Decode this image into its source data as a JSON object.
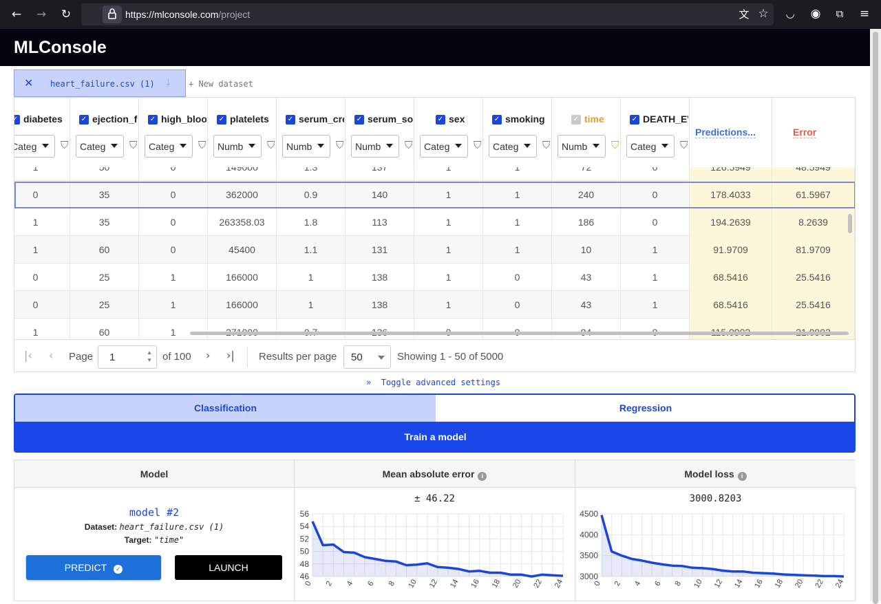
{
  "browser": {
    "url_host": "https://mlconsole.com",
    "url_path": "/project"
  },
  "app": {
    "title": "MLConsole"
  },
  "dataset_tabs": {
    "active": "heart_failure.csv (1)",
    "new_label": "+ New dataset"
  },
  "columns": [
    {
      "name": "diabetes",
      "checked": true,
      "type": "Categ"
    },
    {
      "name": "ejection_fraction",
      "checked": true,
      "type": "Categ"
    },
    {
      "name": "high_blood_pressure",
      "checked": true,
      "type": "Categ"
    },
    {
      "name": "platelets",
      "checked": true,
      "type": "Numb"
    },
    {
      "name": "serum_creatinine",
      "checked": true,
      "type": "Numb"
    },
    {
      "name": "serum_sodium",
      "checked": true,
      "type": "Numb"
    },
    {
      "name": "sex",
      "checked": true,
      "type": "Categ"
    },
    {
      "name": "smoking",
      "checked": true,
      "type": "Categ"
    },
    {
      "name": "time",
      "checked": false,
      "type": "Numb",
      "target": true
    },
    {
      "name": "DEATH_EVENT",
      "checked": true,
      "type": "Categ"
    }
  ],
  "prediction_headers": {
    "predictions": "Predictions...",
    "error": "Error"
  },
  "rows": [
    [
      "1",
      "50",
      "0",
      "149000",
      "1.3",
      "137",
      "1",
      "1",
      "72",
      "0",
      "126.5949",
      "48.5949"
    ],
    [
      "0",
      "35",
      "0",
      "362000",
      "0.9",
      "140",
      "1",
      "1",
      "240",
      "0",
      "178.4033",
      "61.5967"
    ],
    [
      "1",
      "35",
      "0",
      "263358.03",
      "1.8",
      "113",
      "1",
      "1",
      "186",
      "0",
      "194.2639",
      "8.2639"
    ],
    [
      "1",
      "60",
      "0",
      "45400",
      "1.1",
      "131",
      "1",
      "1",
      "10",
      "1",
      "91.9709",
      "81.9709"
    ],
    [
      "0",
      "25",
      "1",
      "166000",
      "1",
      "138",
      "1",
      "0",
      "43",
      "1",
      "68.5416",
      "25.5416"
    ],
    [
      "0",
      "25",
      "1",
      "166000",
      "1",
      "138",
      "1",
      "0",
      "43",
      "1",
      "68.5416",
      "25.5416"
    ],
    [
      "1",
      "60",
      "1",
      "271000",
      "0.7",
      "136",
      "0",
      "0",
      "94",
      "0",
      "115.0902",
      "21.0902"
    ]
  ],
  "pagination": {
    "page_label": "Page",
    "page_value": "1",
    "of_label": "of 100",
    "per_page_label": "Results per page",
    "per_page_value": "50",
    "showing": "Showing 1 - 50 of 5000"
  },
  "advanced_toggle": "Toggle advanced settings",
  "modes": {
    "classification": "Classification",
    "regression": "Regression",
    "active": "classification"
  },
  "train_button": "Train a model",
  "results": {
    "headers": {
      "model": "Model",
      "mae": "Mean absolute error",
      "loss": "Model loss"
    },
    "model": {
      "name": "model #2",
      "dataset_label": "Dataset:",
      "dataset_value": "heart_failure.csv (1)",
      "target_label": "Target:",
      "target_value": "\"time\""
    },
    "predict_button": "PREDICT",
    "launch_button": "LAUNCH",
    "mae_value": "± 46.22",
    "loss_value": "3000.8203"
  },
  "chart_data": [
    {
      "type": "area",
      "x": [
        0,
        1,
        2,
        3,
        4,
        5,
        6,
        7,
        8,
        9,
        10,
        11,
        12,
        13,
        14,
        15,
        16,
        17,
        18,
        19,
        20,
        21,
        22,
        23,
        24
      ],
      "series": [
        {
          "values": [
            54.8,
            51.0,
            51.1,
            49.9,
            49.8,
            49.1,
            48.8,
            48.5,
            48.4,
            47.8,
            47.9,
            48.1,
            47.5,
            47.4,
            47.2,
            46.8,
            46.9,
            46.6,
            46.6,
            46.3,
            46.3,
            46.0,
            46.3,
            46.2,
            46.1
          ]
        }
      ],
      "xticks": [
        0,
        2,
        4,
        6,
        8,
        10,
        12,
        14,
        16,
        18,
        20,
        22,
        24
      ],
      "yticks": [
        46,
        48,
        50,
        52,
        54,
        56
      ],
      "ylim": [
        46,
        56
      ],
      "xlim": [
        0,
        24
      ],
      "color": "#1a47d8",
      "grid": true
    },
    {
      "type": "area",
      "x": [
        0,
        1,
        2,
        3,
        4,
        5,
        6,
        7,
        8,
        9,
        10,
        11,
        12,
        13,
        14,
        15,
        16,
        17,
        18,
        19,
        20,
        21,
        22,
        23,
        24
      ],
      "series": [
        {
          "values": [
            4470,
            3600,
            3500,
            3420,
            3380,
            3330,
            3290,
            3260,
            3250,
            3210,
            3200,
            3180,
            3140,
            3120,
            3120,
            3090,
            3080,
            3070,
            3050,
            3040,
            3030,
            3020,
            3010,
            3010,
            3000
          ]
        }
      ],
      "xticks": [
        0,
        2,
        4,
        6,
        8,
        10,
        12,
        14,
        16,
        18,
        20,
        22,
        24
      ],
      "yticks": [
        3000,
        3500,
        4000,
        4500
      ],
      "ylim": [
        3000,
        4500
      ],
      "xlim": [
        0,
        24
      ],
      "color": "#1a47d8",
      "grid": true
    }
  ]
}
